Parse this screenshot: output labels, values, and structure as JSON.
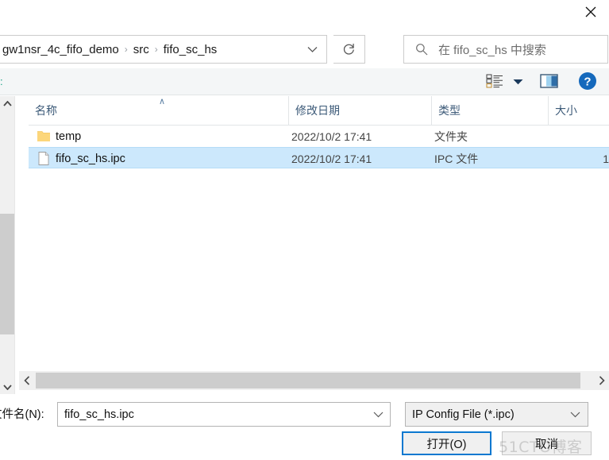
{
  "titlebar": {
    "close_icon": "close-icon"
  },
  "address": {
    "breadcrumb": [
      "gw1nsr_4c_fifo_demo",
      "src",
      "fifo_sc_hs"
    ],
    "separator": "›",
    "dropdown_icon": "chevron-down-icon",
    "refresh_icon": "refresh-icon"
  },
  "search": {
    "icon": "search-icon",
    "placeholder": "在 fifo_sc_hs 中搜索"
  },
  "toolbar": {
    "view_options_icon": "view-options-icon",
    "view_caret_icon": "chevron-down-icon",
    "preview_pane_icon": "preview-pane-icon",
    "help_icon": "help-icon",
    "help_glyph": "?"
  },
  "navpane": {
    "scroll_up_icon": "scroll-up-arrow-icon",
    "scroll_down_icon": "scroll-down-arrow-icon"
  },
  "filelist": {
    "columns": [
      {
        "label": "名称"
      },
      {
        "label": "修改日期"
      },
      {
        "label": "类型"
      },
      {
        "label": "大小"
      }
    ],
    "sort_caret": "∧",
    "rows": [
      {
        "icon": "folder-icon",
        "name": "temp",
        "date": "2022/10/2 17:41",
        "type": "文件夹",
        "size": "",
        "selected": false
      },
      {
        "icon": "file-icon",
        "name": "fifo_sc_hs.ipc",
        "date": "2022/10/2 17:41",
        "type": "IPC 文件",
        "size": "1",
        "selected": true
      }
    ]
  },
  "hscroll": {
    "left_icon": "scroll-left-arrow-icon",
    "right_icon": "scroll-right-arrow-icon"
  },
  "form": {
    "filename_label": "文件名(N):",
    "filename_value": "fifo_sc_hs.ipc",
    "filename_caret_icon": "chevron-down-icon",
    "filetype_value": "IP Config File (*.ipc)",
    "filetype_caret_icon": "chevron-down-icon",
    "open_label": "打开(O)",
    "cancel_label": "取消"
  },
  "watermark": {
    "text": "51CTO博客"
  },
  "colors": {
    "selection": "#cce8fc",
    "focus_border": "#0b78d0",
    "column_header_text": "#3c5a78",
    "folder": "#fcd67b",
    "help_blue": "#1569bc"
  }
}
